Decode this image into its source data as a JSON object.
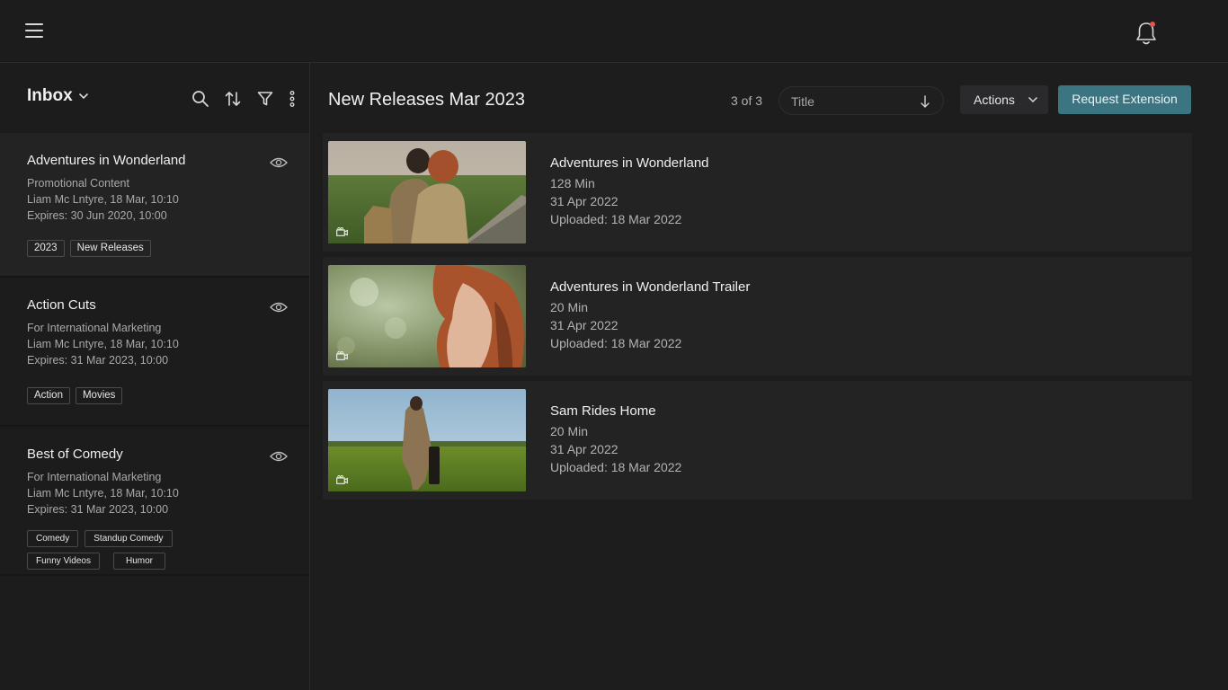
{
  "header": {
    "menu_icon": "hamburger-icon",
    "notification_icon": "bell-icon"
  },
  "sidebar": {
    "title": "Inbox",
    "tools": [
      "search-icon",
      "sort-icon",
      "filter-icon",
      "more-icon"
    ],
    "items": [
      {
        "name": "Adventures in Wonderland",
        "subtitle": "Promotional Content",
        "author": "Liam Mc Lntyre, 18 Mar, 10:10",
        "expires": "Expires: 30 Jun 2020, 10:00",
        "tags": [
          "2023",
          "New Releases"
        ]
      },
      {
        "name": "Action Cuts",
        "subtitle": "For International Marketing",
        "author": "Liam Mc Lntyre, 18 Mar, 10:10",
        "expires": "Expires: 31 Mar 2023, 10:00",
        "tags": [
          "Action",
          "Movies"
        ]
      },
      {
        "name": "Best of Comedy",
        "subtitle": "For International Marketing",
        "author": "Liam Mc Lntyre, 18 Mar, 10:10",
        "expires": "Expires: 31 Mar 2023, 10:00",
        "tags": [
          "Comedy",
          "Standup Comedy",
          "Funny Videos",
          "Humor"
        ]
      }
    ]
  },
  "main": {
    "title": "New Releases Mar 2023",
    "count": "3 of 3",
    "sort_label": "Title",
    "actions_label": "Actions",
    "request_label": "Request Extension",
    "accent_color": "#3b7582",
    "cards": [
      {
        "title": "Adventures in Wonderland",
        "duration": "128 Min",
        "date": "31 Apr 2022",
        "uploaded": "Uploaded:  18 Mar 2022"
      },
      {
        "title": "Adventures in Wonderland Trailer",
        "duration": "20 Min",
        "date": "31 Apr 2022",
        "uploaded": "Uploaded:  18 Mar 2022"
      },
      {
        "title": "Sam Rides Home",
        "duration": "20 Min",
        "date": "31 Apr 2022",
        "uploaded": "Uploaded:  18 Mar 2022"
      }
    ]
  }
}
